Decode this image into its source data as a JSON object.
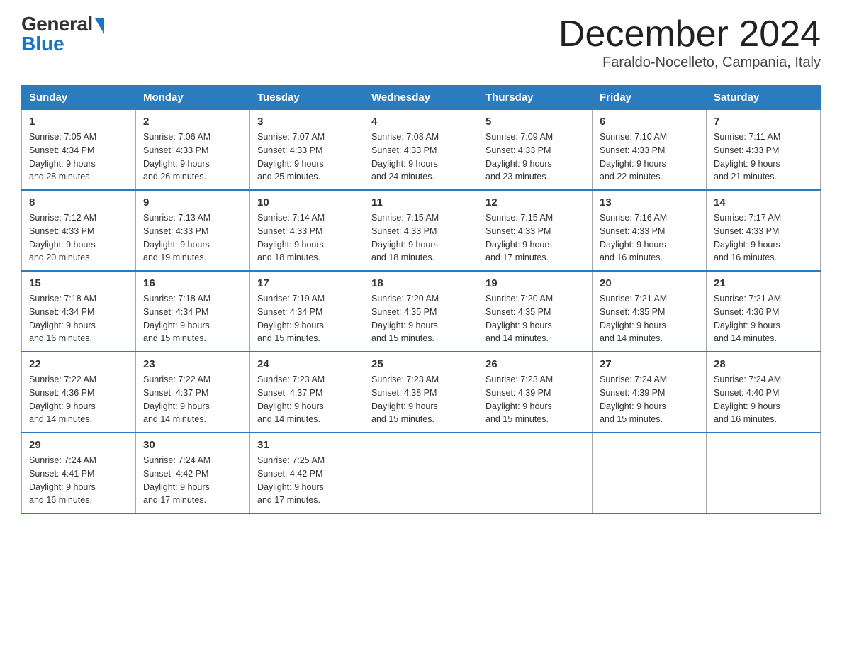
{
  "logo": {
    "general": "General",
    "blue": "Blue"
  },
  "title": "December 2024",
  "location": "Faraldo-Nocelleto, Campania, Italy",
  "days_of_week": [
    "Sunday",
    "Monday",
    "Tuesday",
    "Wednesday",
    "Thursday",
    "Friday",
    "Saturday"
  ],
  "weeks": [
    [
      {
        "day": "1",
        "sunrise": "7:05 AM",
        "sunset": "4:34 PM",
        "daylight": "9 hours and 28 minutes."
      },
      {
        "day": "2",
        "sunrise": "7:06 AM",
        "sunset": "4:33 PM",
        "daylight": "9 hours and 26 minutes."
      },
      {
        "day": "3",
        "sunrise": "7:07 AM",
        "sunset": "4:33 PM",
        "daylight": "9 hours and 25 minutes."
      },
      {
        "day": "4",
        "sunrise": "7:08 AM",
        "sunset": "4:33 PM",
        "daylight": "9 hours and 24 minutes."
      },
      {
        "day": "5",
        "sunrise": "7:09 AM",
        "sunset": "4:33 PM",
        "daylight": "9 hours and 23 minutes."
      },
      {
        "day": "6",
        "sunrise": "7:10 AM",
        "sunset": "4:33 PM",
        "daylight": "9 hours and 22 minutes."
      },
      {
        "day": "7",
        "sunrise": "7:11 AM",
        "sunset": "4:33 PM",
        "daylight": "9 hours and 21 minutes."
      }
    ],
    [
      {
        "day": "8",
        "sunrise": "7:12 AM",
        "sunset": "4:33 PM",
        "daylight": "9 hours and 20 minutes."
      },
      {
        "day": "9",
        "sunrise": "7:13 AM",
        "sunset": "4:33 PM",
        "daylight": "9 hours and 19 minutes."
      },
      {
        "day": "10",
        "sunrise": "7:14 AM",
        "sunset": "4:33 PM",
        "daylight": "9 hours and 18 minutes."
      },
      {
        "day": "11",
        "sunrise": "7:15 AM",
        "sunset": "4:33 PM",
        "daylight": "9 hours and 18 minutes."
      },
      {
        "day": "12",
        "sunrise": "7:15 AM",
        "sunset": "4:33 PM",
        "daylight": "9 hours and 17 minutes."
      },
      {
        "day": "13",
        "sunrise": "7:16 AM",
        "sunset": "4:33 PM",
        "daylight": "9 hours and 16 minutes."
      },
      {
        "day": "14",
        "sunrise": "7:17 AM",
        "sunset": "4:33 PM",
        "daylight": "9 hours and 16 minutes."
      }
    ],
    [
      {
        "day": "15",
        "sunrise": "7:18 AM",
        "sunset": "4:34 PM",
        "daylight": "9 hours and 16 minutes."
      },
      {
        "day": "16",
        "sunrise": "7:18 AM",
        "sunset": "4:34 PM",
        "daylight": "9 hours and 15 minutes."
      },
      {
        "day": "17",
        "sunrise": "7:19 AM",
        "sunset": "4:34 PM",
        "daylight": "9 hours and 15 minutes."
      },
      {
        "day": "18",
        "sunrise": "7:20 AM",
        "sunset": "4:35 PM",
        "daylight": "9 hours and 15 minutes."
      },
      {
        "day": "19",
        "sunrise": "7:20 AM",
        "sunset": "4:35 PM",
        "daylight": "9 hours and 14 minutes."
      },
      {
        "day": "20",
        "sunrise": "7:21 AM",
        "sunset": "4:35 PM",
        "daylight": "9 hours and 14 minutes."
      },
      {
        "day": "21",
        "sunrise": "7:21 AM",
        "sunset": "4:36 PM",
        "daylight": "9 hours and 14 minutes."
      }
    ],
    [
      {
        "day": "22",
        "sunrise": "7:22 AM",
        "sunset": "4:36 PM",
        "daylight": "9 hours and 14 minutes."
      },
      {
        "day": "23",
        "sunrise": "7:22 AM",
        "sunset": "4:37 PM",
        "daylight": "9 hours and 14 minutes."
      },
      {
        "day": "24",
        "sunrise": "7:23 AM",
        "sunset": "4:37 PM",
        "daylight": "9 hours and 14 minutes."
      },
      {
        "day": "25",
        "sunrise": "7:23 AM",
        "sunset": "4:38 PM",
        "daylight": "9 hours and 15 minutes."
      },
      {
        "day": "26",
        "sunrise": "7:23 AM",
        "sunset": "4:39 PM",
        "daylight": "9 hours and 15 minutes."
      },
      {
        "day": "27",
        "sunrise": "7:24 AM",
        "sunset": "4:39 PM",
        "daylight": "9 hours and 15 minutes."
      },
      {
        "day": "28",
        "sunrise": "7:24 AM",
        "sunset": "4:40 PM",
        "daylight": "9 hours and 16 minutes."
      }
    ],
    [
      {
        "day": "29",
        "sunrise": "7:24 AM",
        "sunset": "4:41 PM",
        "daylight": "9 hours and 16 minutes."
      },
      {
        "day": "30",
        "sunrise": "7:24 AM",
        "sunset": "4:42 PM",
        "daylight": "9 hours and 17 minutes."
      },
      {
        "day": "31",
        "sunrise": "7:25 AM",
        "sunset": "4:42 PM",
        "daylight": "9 hours and 17 minutes."
      },
      null,
      null,
      null,
      null
    ]
  ],
  "labels": {
    "sunrise": "Sunrise:",
    "sunset": "Sunset:",
    "daylight": "Daylight:"
  }
}
